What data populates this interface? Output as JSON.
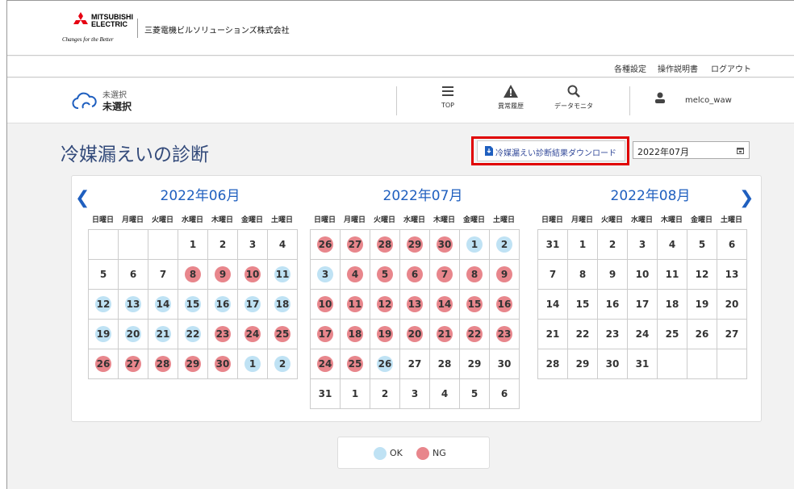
{
  "header": {
    "brand_line1": "MITSUBISHI",
    "brand_line2": "ELECTRIC",
    "tagline": "Changes for the Better",
    "company": "三菱電機ビルソリューションズ株式会社",
    "brand_color": "#e60012"
  },
  "util_links": [
    "各種設定",
    "操作説明書",
    "ログアウト"
  ],
  "selection": {
    "line1": "未選択",
    "line2": "未選択"
  },
  "nav": [
    {
      "label": "TOP",
      "icon": "menu-icon"
    },
    {
      "label": "異常履歴",
      "icon": "warning-icon"
    },
    {
      "label": "データモニタ",
      "icon": "search-icon"
    }
  ],
  "user": {
    "name": "melco_waw",
    "icon": "user-icon"
  },
  "page": {
    "title": "冷媒漏えいの診断",
    "download_label": "冷媒漏えい診断結果ダウンロード",
    "month_value": "2022年07月",
    "accent": "#1f5fbf"
  },
  "weekdays": [
    "日曜日",
    "月曜日",
    "火曜日",
    "水曜日",
    "木曜日",
    "金曜日",
    "土曜日"
  ],
  "calendars": [
    {
      "title": "2022年06月",
      "weeks": [
        [
          "",
          "",
          "",
          "1",
          "2",
          "3",
          "4"
        ],
        [
          "5",
          "6",
          "7",
          "8:ng",
          "9:ng",
          "10:ng",
          "11:ok"
        ],
        [
          "12:ok",
          "13:ok",
          "14:ok",
          "15:ok",
          "16:ok",
          "17:ok",
          "18:ok"
        ],
        [
          "19:ok",
          "20:ok",
          "21:ok",
          "22:ok",
          "23:ng",
          "24:ng",
          "25:ng"
        ],
        [
          "26:ng",
          "27:ng",
          "28:ng",
          "29:ng",
          "30:ng",
          "1:ok",
          "2:ok"
        ]
      ]
    },
    {
      "title": "2022年07月",
      "weeks": [
        [
          "26:ng",
          "27:ng",
          "28:ng",
          "29:ng",
          "30:ng",
          "1:ok",
          "2:ok"
        ],
        [
          "3:ok",
          "4:ng",
          "5:ng",
          "6:ng",
          "7:ng",
          "8:ng",
          "9:ng"
        ],
        [
          "10:ng",
          "11:ng",
          "12:ng",
          "13:ng",
          "14:ng",
          "15:ng",
          "16:ng"
        ],
        [
          "17:ng",
          "18:ng",
          "19:ng",
          "20:ng",
          "21:ng",
          "22:ng",
          "23:ng"
        ],
        [
          "24:ng",
          "25:ng",
          "26:ok",
          "27",
          "28",
          "29",
          "30"
        ],
        [
          "31",
          "1",
          "2",
          "3",
          "4",
          "5",
          "6"
        ]
      ]
    },
    {
      "title": "2022年08月",
      "weeks": [
        [
          "31",
          "1",
          "2",
          "3",
          "4",
          "5",
          "6"
        ],
        [
          "7",
          "8",
          "9",
          "10",
          "11",
          "12",
          "13"
        ],
        [
          "14",
          "15",
          "16",
          "17",
          "18",
          "19",
          "20"
        ],
        [
          "21",
          "22",
          "23",
          "24",
          "25",
          "26",
          "27"
        ],
        [
          "28",
          "29",
          "30",
          "31",
          "",
          "",
          ""
        ]
      ]
    }
  ],
  "legend": {
    "ok_label": "OK",
    "ng_label": "NG",
    "ok_color": "#bfe2f4",
    "ng_color": "#e8868c"
  }
}
